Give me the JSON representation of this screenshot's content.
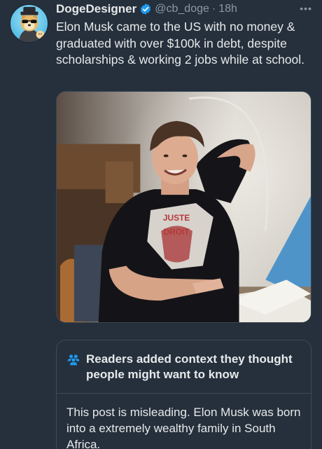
{
  "user": {
    "display_name": "DogeDesigner",
    "handle": "@cb_doge",
    "separator": "·",
    "time": "18h",
    "avatar_icon": "doge-avatar",
    "verified_icon": "verified-badge-icon"
  },
  "more_label": "•••",
  "tweet": {
    "text": "Elon Musk came to the US with no money & graduated with over $100k in debt, despite scholarships & working 2 jobs while at school."
  },
  "photo": {
    "shirt_text_line1": "JUSTE",
    "shirt_text_line2": "DROIT"
  },
  "community_note": {
    "icon": "people-icon",
    "title": "Readers added context they thought people might want to know",
    "body": "This post is misleading. Elon Musk was born into a extremely wealthy family in South Africa."
  },
  "colors": {
    "background": "#25303c",
    "text_primary": "#e7e9ea",
    "text_secondary": "#8b98a5",
    "verified": "#1d9bf0",
    "note_icon": "#1d9bf0"
  }
}
